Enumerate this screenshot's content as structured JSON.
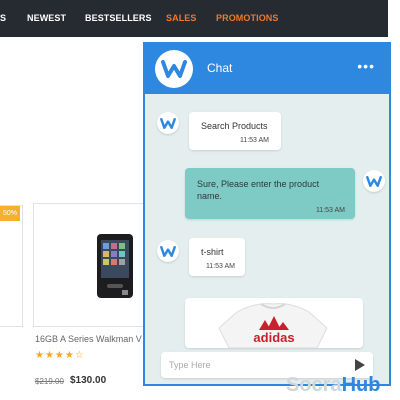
{
  "nav": {
    "items": [
      {
        "label": "S"
      },
      {
        "label": "NEWEST"
      },
      {
        "label": "BESTSELLERS"
      },
      {
        "label": "SALES"
      },
      {
        "label": "PROMOTIONS"
      }
    ]
  },
  "store": {
    "sale_badge": "50%",
    "product": {
      "title": "16GB A Series Walkman V",
      "rating": 4.5,
      "rating_max": 5,
      "stars": "★★★★☆",
      "price_old": "$219.00",
      "price_new": "$130.00"
    }
  },
  "chat": {
    "title": "Chat",
    "menu": "•••",
    "messages": [
      {
        "from": "bot",
        "text": "Search Products",
        "time": "11:53 AM"
      },
      {
        "from": "user",
        "text": "Sure, Please enter the product name.",
        "time": "11:53 AM"
      },
      {
        "from": "bot",
        "text": "t-shirt",
        "time": "11:53 AM"
      }
    ],
    "product_brand": "adidas",
    "input_placeholder": "Type Here"
  },
  "watermark": {
    "part1": "Socra",
    "part2": "Hub"
  },
  "colors": {
    "accent": "#2f88e0",
    "nav_bg": "#262a31",
    "hot": "#f0782d",
    "user_bubble": "#7ecac4",
    "chat_bg": "#e4eeee"
  },
  "icons": {
    "logo": "w-logo-icon",
    "send": "send-icon",
    "menu": "more-dots-icon"
  }
}
